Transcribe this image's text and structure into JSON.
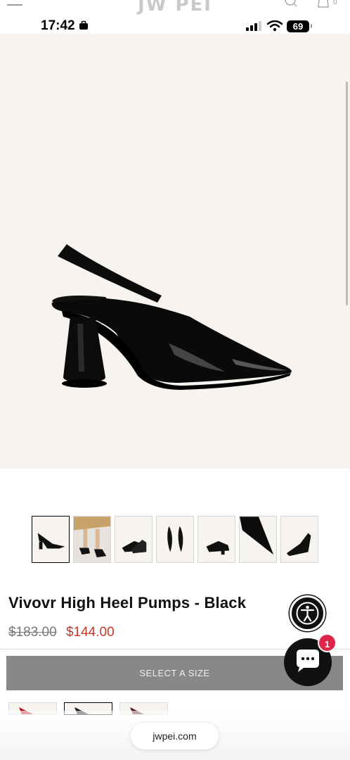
{
  "site": {
    "brand": "JW PEI",
    "cart_count": "0"
  },
  "status_bar": {
    "time": "17:42",
    "battery": "69"
  },
  "gallery": {
    "thumbnail_count": 7,
    "thumbnail_icons": [
      "shoe-side-icon",
      "model-legs-icon",
      "shoe-pair-icon",
      "shoe-top-icon",
      "shoe-back-icon",
      "shoe-toe-closeup-icon",
      "shoe-angle-icon"
    ]
  },
  "product": {
    "title": "Vivovr High Heel Pumps - Black",
    "price_original": "$183.00",
    "price_sale": "$144.00"
  },
  "actions": {
    "size_button": "SELECT A SIZE"
  },
  "chat": {
    "badge": "1"
  },
  "browser": {
    "url": "jwpei.com"
  },
  "colors": {
    "sale": "#c0392b",
    "badge": "#e0254a",
    "hero_bg": "#f7f3ee",
    "button": "#888888"
  }
}
